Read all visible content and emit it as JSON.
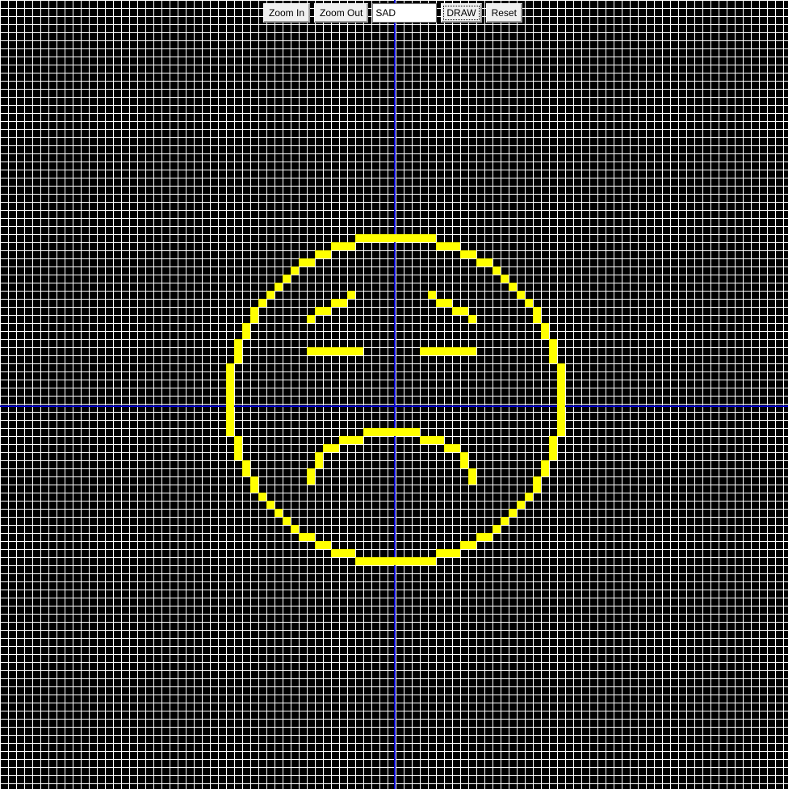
{
  "toolbar": {
    "zoom_in_label": "Zoom In",
    "zoom_out_label": "Zoom Out",
    "command_value": "SAD",
    "draw_label": "DRAW",
    "reset_label": "Reset"
  },
  "canvas": {
    "background_color": "#000000",
    "grid_color": "#ffffff",
    "axis_color": "#0000cc",
    "pixel_color": "#ffff00"
  },
  "drawing": {
    "name": "sad-face",
    "segments": [
      [
        44,
        29,
        53,
        29
      ],
      [
        41,
        30,
        43,
        30
      ],
      [
        54,
        30,
        56,
        30
      ],
      [
        39,
        31,
        40,
        31
      ],
      [
        57,
        31,
        58,
        31
      ],
      [
        37,
        32,
        38,
        32
      ],
      [
        59,
        32,
        60,
        32
      ],
      [
        36,
        33,
        36,
        33
      ],
      [
        61,
        33,
        61,
        33
      ],
      [
        35,
        34,
        35,
        34
      ],
      [
        62,
        34,
        62,
        34
      ],
      [
        34,
        35,
        34,
        35
      ],
      [
        63,
        35,
        63,
        35
      ],
      [
        33,
        36,
        33,
        36
      ],
      [
        64,
        36,
        64,
        36
      ],
      [
        32,
        37,
        32,
        37
      ],
      [
        65,
        37,
        65,
        37
      ],
      [
        31,
        38,
        31,
        39
      ],
      [
        66,
        38,
        66,
        39
      ],
      [
        30,
        40,
        30,
        41
      ],
      [
        67,
        40,
        67,
        41
      ],
      [
        29,
        42,
        29,
        44
      ],
      [
        68,
        42,
        68,
        44
      ],
      [
        28,
        45,
        28,
        53
      ],
      [
        69,
        45,
        69,
        53
      ],
      [
        29,
        54,
        29,
        56
      ],
      [
        68,
        54,
        68,
        56
      ],
      [
        30,
        57,
        30,
        58
      ],
      [
        67,
        57,
        67,
        58
      ],
      [
        31,
        59,
        31,
        60
      ],
      [
        66,
        59,
        66,
        60
      ],
      [
        32,
        61,
        32,
        61
      ],
      [
        65,
        61,
        65,
        61
      ],
      [
        33,
        62,
        33,
        62
      ],
      [
        64,
        62,
        64,
        62
      ],
      [
        34,
        63,
        34,
        63
      ],
      [
        63,
        63,
        63,
        63
      ],
      [
        35,
        64,
        35,
        64
      ],
      [
        62,
        64,
        62,
        64
      ],
      [
        36,
        65,
        36,
        65
      ],
      [
        61,
        65,
        61,
        65
      ],
      [
        37,
        66,
        38,
        66
      ],
      [
        59,
        66,
        60,
        66
      ],
      [
        39,
        67,
        40,
        67
      ],
      [
        57,
        67,
        58,
        67
      ],
      [
        41,
        68,
        43,
        68
      ],
      [
        54,
        68,
        56,
        68
      ],
      [
        44,
        69,
        53,
        69
      ],
      [
        43,
        36,
        43,
        36
      ],
      [
        41,
        37,
        42,
        37
      ],
      [
        39,
        38,
        40,
        38
      ],
      [
        38,
        39,
        38,
        39
      ],
      [
        53,
        36,
        53,
        36
      ],
      [
        54,
        37,
        55,
        37
      ],
      [
        56,
        38,
        57,
        38
      ],
      [
        58,
        39,
        58,
        39
      ],
      [
        38,
        43,
        44,
        43
      ],
      [
        52,
        43,
        58,
        43
      ],
      [
        45,
        53,
        51,
        53
      ],
      [
        42,
        54,
        44,
        54
      ],
      [
        52,
        54,
        54,
        54
      ],
      [
        40,
        55,
        41,
        55
      ],
      [
        55,
        55,
        56,
        55
      ],
      [
        39,
        56,
        39,
        57
      ],
      [
        57,
        56,
        57,
        57
      ],
      [
        38,
        58,
        38,
        59
      ],
      [
        58,
        58,
        58,
        59
      ]
    ]
  }
}
